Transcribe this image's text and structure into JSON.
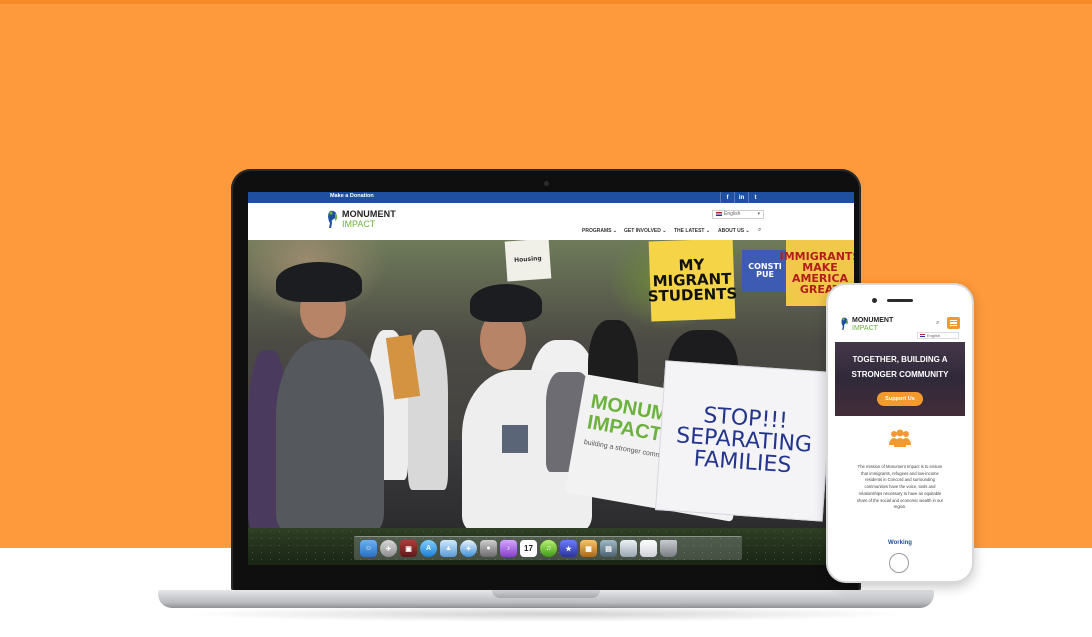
{
  "laptop_site": {
    "topbar": {
      "donate_label": "Make a Donation",
      "social": [
        "f",
        "in",
        "t"
      ]
    },
    "logo": {
      "line1": "MONUMENT",
      "line2": "IMPACT"
    },
    "language": "English",
    "nav": [
      "PROGRAMS",
      "GET INVOLVED",
      "THE LATEST",
      "ABOUT US"
    ],
    "hero_signs": {
      "migrant": "MY\nMIGRANT\nSTUDENTS",
      "america": "IMMIGRANTS\nMAKE\nAMERICA\nGREAT",
      "const": "CONSTI\nPUE",
      "stop": "STOP!!!\nSEPARATING\nFAMILIES",
      "banner_title": "MONUMENT\nIMPACT",
      "banner_sub": "building a stronger community",
      "small": "Housing"
    }
  },
  "dock": {
    "icons": [
      "finder-icon",
      "launchpad-icon",
      "photo-booth-icon",
      "app-store-icon",
      "preview-icon",
      "safari-icon",
      "facetime-icon",
      "itunes-icon",
      "calendar-icon",
      "music-icon",
      "imovie-icon",
      "iphoto-icon",
      "iphoto-2-icon",
      "folder-icon",
      "documents-icon",
      "trash-icon"
    ],
    "calendar_day": "17"
  },
  "phone_site": {
    "logo": {
      "line1": "MONUMENT",
      "line2": "IMPACT"
    },
    "language": "English",
    "hero_title_line1": "TOGETHER, BUILDING A",
    "hero_title_line2": "STRONGER COMMUNITY",
    "support_label": "Support Us",
    "mission": "The mission of Monument Impact is to ensure that immigrants, refugees and low-income residents in Concord and surrounding communities have the voice, tools and relationships necessary to have an equitable share of the social and economic wealth in our region.",
    "working_label": "Working"
  },
  "colors": {
    "orange_bg": "#FF9A3C",
    "brand_blue": "#1F4FA0",
    "brand_green": "#6CB33E",
    "accent_orange": "#F39A2F"
  }
}
